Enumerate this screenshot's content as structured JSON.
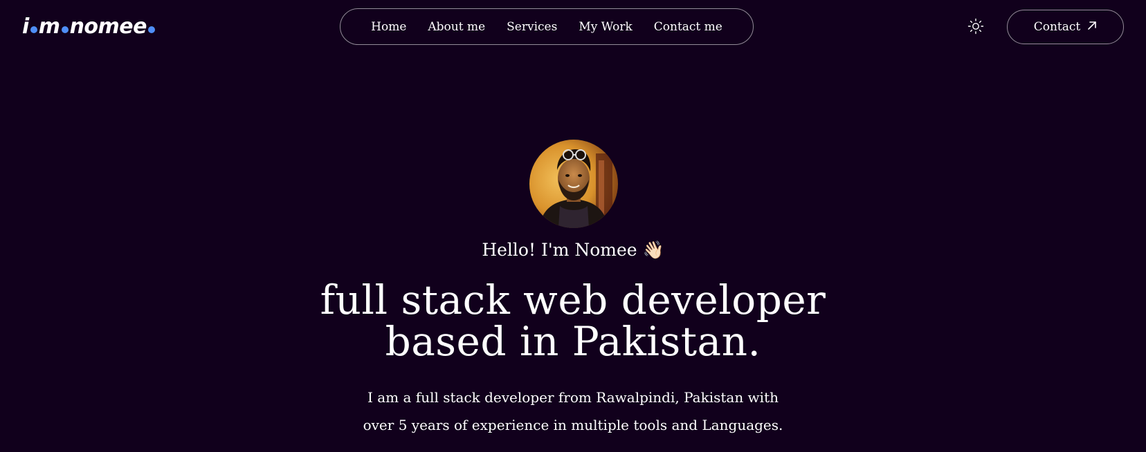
{
  "brand": {
    "logo_parts": [
      "i",
      "m",
      "nomee"
    ],
    "dot_color": "#4f8ef7"
  },
  "nav": {
    "items": [
      {
        "label": "Home"
      },
      {
        "label": "About me"
      },
      {
        "label": "Services"
      },
      {
        "label": "My Work"
      },
      {
        "label": "Contact me"
      }
    ]
  },
  "header": {
    "theme_toggle_icon": "sun-icon",
    "contact_label": "Contact",
    "contact_icon": "arrow-up-right-icon"
  },
  "hero": {
    "avatar_alt": "profile-photo",
    "greeting": "Hello! I'm Nomee 👋🏻",
    "headline_line1": "full stack web developer",
    "headline_line2": "based in Pakistan.",
    "intro_line1": "I am a full stack developer from Rawalpindi, Pakistan with",
    "intro_line2": "over 5 years of experience in multiple tools and Languages."
  },
  "colors": {
    "background": "#11001c",
    "text": "#ffffff",
    "accent": "#4f8ef7"
  }
}
